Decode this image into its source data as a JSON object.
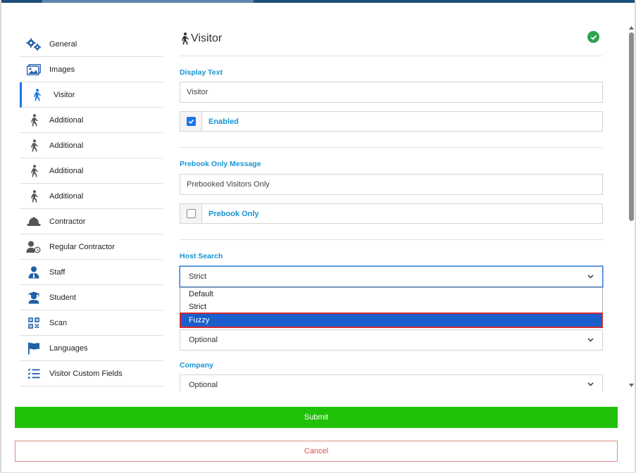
{
  "sidebar": {
    "items": [
      {
        "label": "General",
        "icon": "gears-icon"
      },
      {
        "label": "Images",
        "icon": "images-icon"
      },
      {
        "label": "Visitor",
        "icon": "walking-person-icon",
        "active": true
      },
      {
        "label": "Additional",
        "icon": "walking-person-icon"
      },
      {
        "label": "Additional",
        "icon": "walking-person-icon"
      },
      {
        "label": "Additional",
        "icon": "walking-person-icon"
      },
      {
        "label": "Additional",
        "icon": "walking-person-icon"
      },
      {
        "label": "Contractor",
        "icon": "hard-hat-icon"
      },
      {
        "label": "Regular Contractor",
        "icon": "user-clock-icon"
      },
      {
        "label": "Staff",
        "icon": "user-tie-icon"
      },
      {
        "label": "Student",
        "icon": "graduate-icon"
      },
      {
        "label": "Scan",
        "icon": "qr-code-icon"
      },
      {
        "label": "Languages",
        "icon": "flag-icon"
      },
      {
        "label": "Visitor Custom Fields",
        "icon": "checklist-icon"
      }
    ]
  },
  "main": {
    "title": "Visitor",
    "display_text": {
      "label": "Display Text",
      "value": "Visitor"
    },
    "enabled": {
      "label": "Enabled",
      "checked": true
    },
    "prebook_message": {
      "label": "Prebook Only Message",
      "value": "Prebooked Visitors Only"
    },
    "prebook_only": {
      "label": "Prebook Only",
      "checked": false
    },
    "host_search": {
      "label": "Host Search",
      "value": "Strict",
      "options": [
        "Default",
        "Strict",
        "Fuzzy"
      ],
      "highlighted": "Fuzzy"
    },
    "hidden_field_select": {
      "value": "Optional"
    },
    "company": {
      "label": "Company",
      "value": "Optional"
    }
  },
  "actions": {
    "submit": "Submit",
    "cancel": "Cancel"
  },
  "colors": {
    "accent": "#1895d2",
    "submit": "#21c10a",
    "cancel": "#d9534f",
    "selected_option": "#1a5fcc",
    "success": "#2ea44f"
  }
}
